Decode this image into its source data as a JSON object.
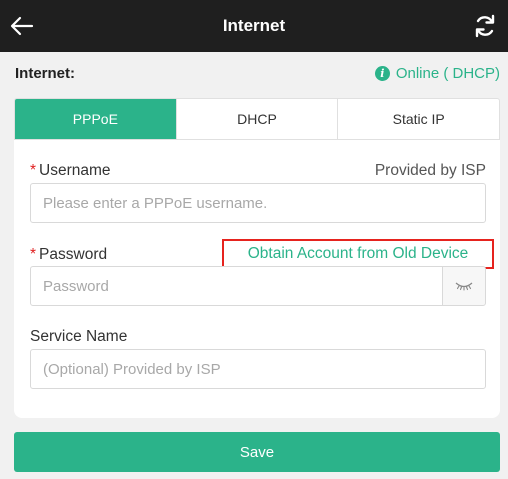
{
  "header": {
    "title": "Internet",
    "back_icon": "arrow-left-icon",
    "refresh_icon": "refresh-icon"
  },
  "status": {
    "label": "Internet:",
    "value": "Online ( DHCP)",
    "icon": "info-icon"
  },
  "tabs": [
    {
      "label": "PPPoE",
      "active": true
    },
    {
      "label": "DHCP",
      "active": false
    },
    {
      "label": "Static IP",
      "active": false
    }
  ],
  "form": {
    "required_mark": "*",
    "username": {
      "label": "Username",
      "hint": "Provided by ISP",
      "value": "",
      "placeholder": "Please enter a PPPoE username."
    },
    "password": {
      "label": "Password",
      "link": "Obtain Account from Old Device",
      "value": "",
      "placeholder": "Password",
      "toggle_icon": "eye-closed-icon"
    },
    "service_name": {
      "label": "Service Name",
      "value": "",
      "placeholder": "(Optional) Provided by ISP"
    }
  },
  "save_label": "Save",
  "colors": {
    "accent": "#2bb38a",
    "header_bg": "#1f1f1f",
    "highlight_border": "#e6231e",
    "required": "#e02020"
  }
}
